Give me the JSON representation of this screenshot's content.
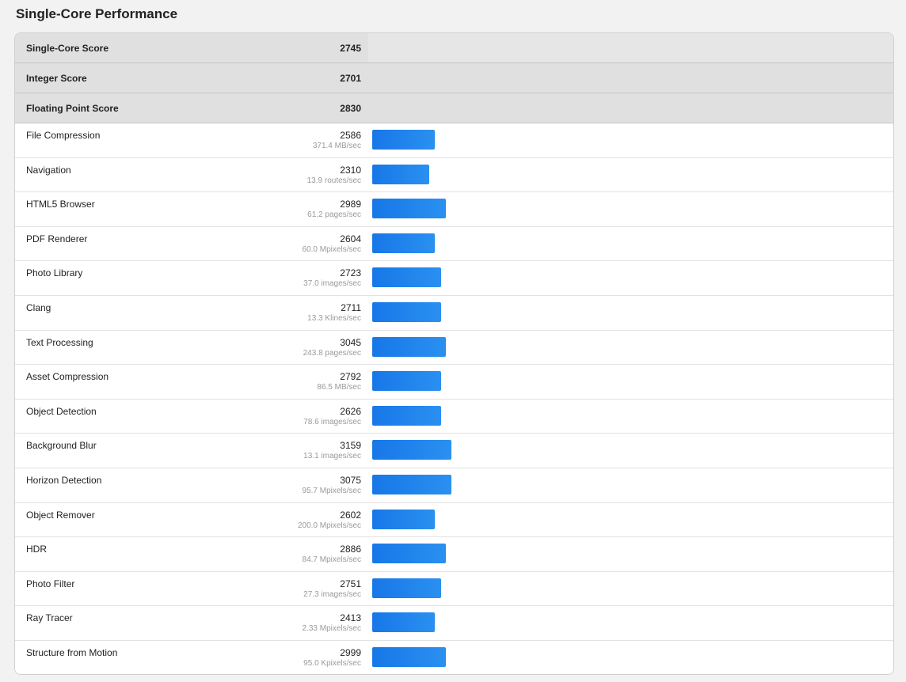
{
  "page_title": "Single-Core Performance",
  "summary": [
    {
      "label": "Single-Core Score",
      "score": "2745"
    },
    {
      "label": "Integer Score",
      "score": "2701"
    },
    {
      "label": "Floating Point Score",
      "score": "2830"
    }
  ],
  "bar_color": "#1a7ff0",
  "benchmarks": [
    {
      "name": "File Compression",
      "score": "2586",
      "rate": "371.4 MB/sec",
      "bar_fraction": 0.071
    },
    {
      "name": "Navigation",
      "score": "2310",
      "rate": "13.9 routes/sec",
      "bar_fraction": 0.065
    },
    {
      "name": "HTML5 Browser",
      "score": "2989",
      "rate": "61.2 pages/sec",
      "bar_fraction": 0.084
    },
    {
      "name": "PDF Renderer",
      "score": "2604",
      "rate": "60.0 Mpixels/sec",
      "bar_fraction": 0.071
    },
    {
      "name": "Photo Library",
      "score": "2723",
      "rate": "37.0 images/sec",
      "bar_fraction": 0.078
    },
    {
      "name": "Clang",
      "score": "2711",
      "rate": "13.3 Klines/sec",
      "bar_fraction": 0.078
    },
    {
      "name": "Text Processing",
      "score": "3045",
      "rate": "243.8 pages/sec",
      "bar_fraction": 0.084
    },
    {
      "name": "Asset Compression",
      "score": "2792",
      "rate": "86.5 MB/sec",
      "bar_fraction": 0.078
    },
    {
      "name": "Object Detection",
      "score": "2626",
      "rate": "78.6 images/sec",
      "bar_fraction": 0.078
    },
    {
      "name": "Background Blur",
      "score": "3159",
      "rate": "13.1 images/sec",
      "bar_fraction": 0.09
    },
    {
      "name": "Horizon Detection",
      "score": "3075",
      "rate": "95.7 Mpixels/sec",
      "bar_fraction": 0.09
    },
    {
      "name": "Object Remover",
      "score": "2602",
      "rate": "200.0 Mpixels/sec",
      "bar_fraction": 0.071
    },
    {
      "name": "HDR",
      "score": "2886",
      "rate": "84.7 Mpixels/sec",
      "bar_fraction": 0.084
    },
    {
      "name": "Photo Filter",
      "score": "2751",
      "rate": "27.3 images/sec",
      "bar_fraction": 0.078
    },
    {
      "name": "Ray Tracer",
      "score": "2413",
      "rate": "2.33 Mpixels/sec",
      "bar_fraction": 0.071
    },
    {
      "name": "Structure from Motion",
      "score": "2999",
      "rate": "95.0 Kpixels/sec",
      "bar_fraction": 0.084
    }
  ]
}
